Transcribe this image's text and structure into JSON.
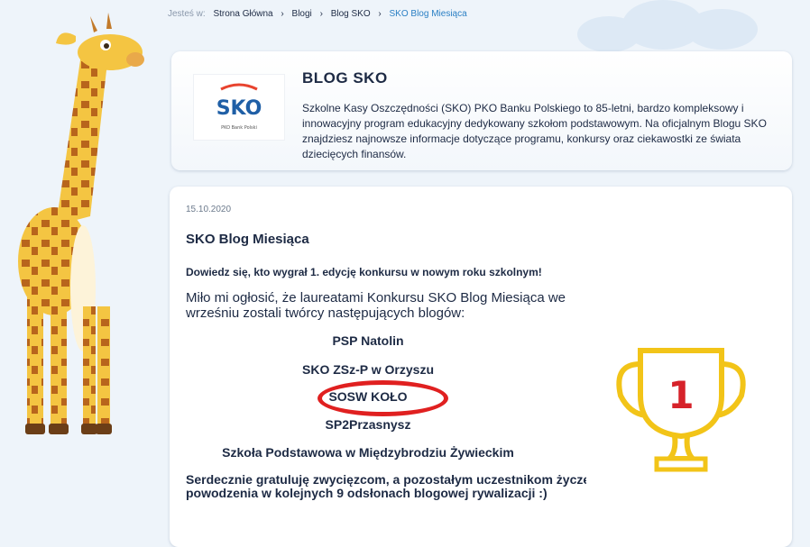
{
  "breadcrumb": {
    "label": "Jesteś w:",
    "items": [
      "Strona Główna",
      "Blogi",
      "Blog SKO",
      "SKO Blog Miesiąca"
    ]
  },
  "blog": {
    "logo_text": "SKO",
    "logo_sub": "PKO Bank Polski",
    "title": "BLOG SKO",
    "description": "Szkolne Kasy Oszczędności (SKO) PKO Banku Polskiego to 85-letni, bardzo kompleksowy i innowacyjny program edukacyjny dedykowany szkołom podstawowym. Na oficjalnym Blogu SKO znajdziesz najnowsze informacje dotyczące programu, konkursy oraz ciekawostki ze świata dziecięcych finansów."
  },
  "post": {
    "date": "15.10.2020",
    "title": "SKO Blog Miesiąca",
    "lead": "Dowiedz się, kto wygrał 1. edycję konkursu w nowym roku szkolnym!",
    "intro": "Miło mi ogłosić, że laureatami Konkursu SKO Blog Miesiąca we wrześniu zostali twórcy następujących blogów:",
    "winners": [
      "PSP Natolin",
      "SKO ZSz-P w Orzyszu",
      "SOSW KOŁO",
      "SP2Przasnysz",
      "Szkoła Podstawowa w Międzybrodziu Żywieckim"
    ],
    "congrats": "Serdecznie gratuluję zwycięzcom, a pozostałym uczestnikom życzę powodzenia w kolejnych 9 odsłonach blogowej rywalizacji :)",
    "trophy_number": "1"
  },
  "colors": {
    "accent": "#2a7fc4",
    "highlight": "#e02020",
    "trophy": "#f2c418"
  }
}
